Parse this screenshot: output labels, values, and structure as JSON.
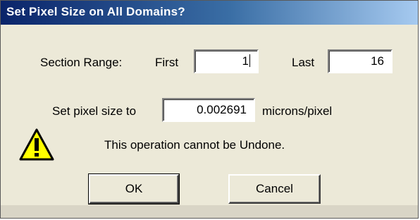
{
  "dialog": {
    "title": "Set Pixel Size on All Domains?"
  },
  "section_range": {
    "label": "Section Range:",
    "first_label": "First",
    "first_value": "1",
    "last_label": "Last",
    "last_value": "16"
  },
  "pixel_size": {
    "label": "Set pixel size to",
    "value": "0.002691",
    "unit": "microns/pixel"
  },
  "warning": {
    "icon": "warning-triangle-icon",
    "message": "This operation cannot be Undone."
  },
  "buttons": {
    "ok": "OK",
    "cancel": "Cancel"
  },
  "colors": {
    "title_bar_start": "#0a246a",
    "title_bar_end": "#a6caf0",
    "dialog_bg": "#ece9d8",
    "warning_fill": "#ffff00"
  }
}
